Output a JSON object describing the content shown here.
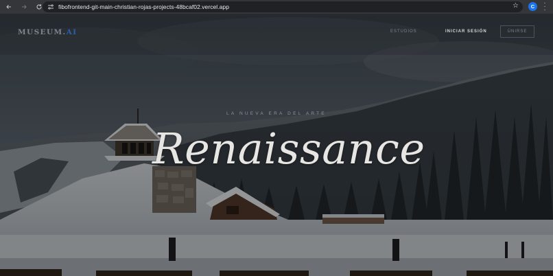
{
  "browser": {
    "url": "fibofrontend-git-main-christian-rojas-projects-48bcaf02.vercel.app",
    "profile_initial": "C",
    "icons": [
      "back-icon",
      "forward-icon",
      "reload-icon",
      "site-settings-icon",
      "bookmark-star-icon",
      "menu-icon"
    ]
  },
  "site": {
    "logo_main": "MUSEUM.",
    "logo_accent": "AI",
    "nav": {
      "link_hidden": "",
      "estudios": "ESTUDIOS",
      "login": "INICIAR SESIÓN",
      "join": "ÚNIRSE"
    },
    "hero": {
      "eyebrow": "LA NUEVA ERA DEL ARTE",
      "title": "Renaissance"
    }
  },
  "colors": {
    "chrome_bg": "#35363a",
    "omnibox_bg": "#202124",
    "logo_accent": "#2f5ea8",
    "profile": "#1a73e8"
  }
}
